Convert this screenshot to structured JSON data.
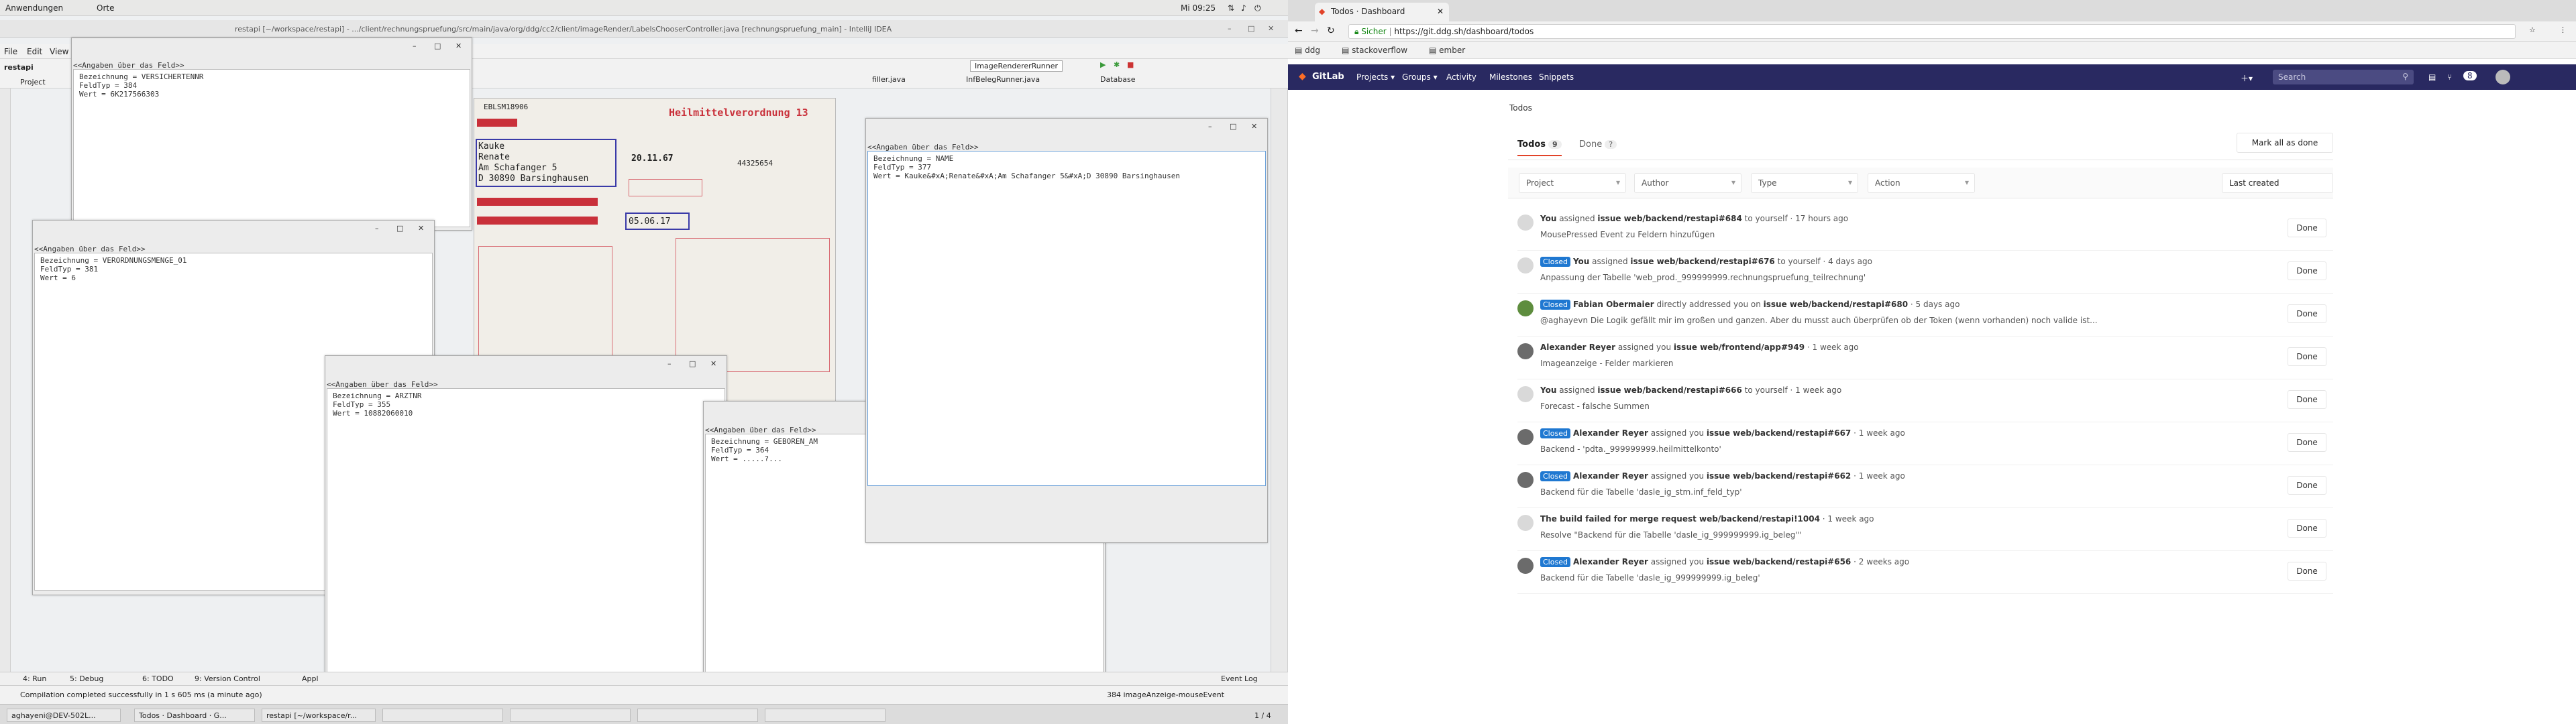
{
  "topbar": {
    "apps": "Anwendungen",
    "places": "Orte",
    "clock": "Mi 09:25"
  },
  "idea": {
    "title": "restapi [~/workspace/restapi] - .../client/rechnungspruefung/src/main/java/org/ddg/cc2/client/imageRender/LabelsChooserController.java [rechnungspruefung_main] - IntelliJ IDEA",
    "menu": [
      "File",
      "Edit",
      "View"
    ],
    "project_tab": "restapi",
    "project_label": "Project",
    "run_config": "ImageRendererRunner",
    "editor_tabs": [
      "filler.java",
      "InfBelegRunner.java"
    ],
    "database_label": "Database",
    "bottom_tabs": [
      "4: Run",
      "5: Debug",
      "6: TODO",
      "9: Version Control",
      "Appl"
    ],
    "event_log": "Event Log",
    "status": "Compilation completed successfully in 1 s 605 ms (a minute ago)",
    "status_right": "384 imageAnzeige-mouseEvent",
    "page_count": "1 / 4"
  },
  "dialogs": [
    {
      "header": "<<Angaben über das Feld>>",
      "lines": [
        "Bezeichnung = VERSICHERTENNR",
        "FeldTyp = 384",
        "Wert = 6K217566303"
      ]
    },
    {
      "header": "<<Angaben über das Feld>>",
      "lines": [
        "Bezeichnung = VERORDNUNGSMENGE_01",
        "FeldTyp = 381",
        "Wert = 6"
      ]
    },
    {
      "header": "<<Angaben über das Feld>>",
      "lines": [
        "Bezeichnung = ARZTNR",
        "FeldTyp = 355",
        "Wert = 10882060010"
      ]
    },
    {
      "header": "<<Angaben über das Feld>>",
      "lines": [
        "Bezeichnung = GEBOREN_AM",
        "FeldTyp = 364",
        "Wert = .....?..."
      ]
    },
    {
      "header": "<<Angaben über das Feld>>",
      "lines": [
        "Bezeichnung = NAME",
        "FeldTyp = 377",
        "Wert = Kauke&#xA;Renate&#xA;Am Schafanger 5&#xA;D 30890 Barsinghausen"
      ]
    }
  ],
  "scan": {
    "form_title": "Heilmittelverordnung 13",
    "name1": "Kauke",
    "name2": "Renate",
    "street": "Am Schafanger 5",
    "city": "D 30890 Barsinghausen",
    "date1": "20.11.67",
    "date2": "05.06.17",
    "number": "44325654",
    "ebls": "EBLSM18906"
  },
  "taskbar": [
    "aghayeni@DEV-502L...",
    "Todos · Dashboard · G...",
    "restapi [~/workspace/r..."
  ],
  "browser": {
    "tab_title": "Todos · Dashboard",
    "secure": "Sicher",
    "url": "https://git.ddg.sh/dashboard/todos",
    "bookmarks": [
      "ddg",
      "stackoverflow",
      "ember"
    ]
  },
  "gitlab": {
    "brand": "GitLab",
    "nav": [
      "Projects ▾",
      "Groups ▾",
      "Activity",
      "Milestones",
      "Snippets"
    ],
    "search_placeholder": "Search",
    "todo_count": "8",
    "page_title": "Todos",
    "tab_todos": "Todos",
    "tab_todos_count": "9",
    "tab_done": "Done",
    "tab_done_count": "?",
    "mark_all": "Mark all as done",
    "filters": [
      "Project",
      "Author",
      "Type",
      "Action"
    ],
    "sort": "Last created",
    "done_label": "Done",
    "todos": [
      {
        "closed": "",
        "actor": "You",
        "text": " assigned ",
        "ref": "issue web/backend/restapi#684",
        "tail": " to yourself · 17 hours ago",
        "desc": "MousePressed Event zu Feldern hinzufügen",
        "avatar": "default"
      },
      {
        "closed": "Closed",
        "actor": "You",
        "text": " assigned ",
        "ref": "issue web/backend/restapi#676",
        "tail": " to yourself · 4 days ago",
        "desc": "Anpassung der Tabelle 'web_prod._999999999.rechnungspruefung_teilrechnung'",
        "avatar": "default"
      },
      {
        "closed": "Closed",
        "actor": "Fabian Obermaier",
        "text": " directly addressed you on ",
        "ref": "issue web/backend/restapi#680",
        "tail": " · 5 days ago",
        "desc": "@aghayevn Die Logik gefällt mir im großen und ganzen. Aber du musst auch überprüfen ob der Token (wenn vorhanden) noch valide ist...",
        "avatar": "green"
      },
      {
        "closed": "",
        "actor": "Alexander Reyer",
        "text": " assigned you ",
        "ref": "issue web/frontend/app#949",
        "tail": " · 1 week ago",
        "desc": "Imageanzeige - Felder markieren",
        "avatar": "photo"
      },
      {
        "closed": "",
        "actor": "You",
        "text": " assigned ",
        "ref": "issue web/backend/restapi#666",
        "tail": " to yourself · 1 week ago",
        "desc": "Forecast - falsche Summen",
        "avatar": "default"
      },
      {
        "closed": "Closed",
        "actor": "Alexander Reyer",
        "text": " assigned you ",
        "ref": "issue web/backend/restapi#667",
        "tail": " · 1 week ago",
        "desc": "Backend - 'pdta._999999999.heilmittelkonto'",
        "avatar": "photo"
      },
      {
        "closed": "Closed",
        "actor": "Alexander Reyer",
        "text": " assigned you ",
        "ref": "issue web/backend/restapi#662",
        "tail": " · 1 week ago",
        "desc": "Backend für die Tabelle 'dasle_ig_stm.inf_feld_typ'",
        "avatar": "photo"
      },
      {
        "closed": "",
        "actor": "The build failed for ",
        "text": "",
        "ref": "merge request web/backend/restapi!1004",
        "tail": " · 1 week ago",
        "desc": "Resolve \"Backend für die Tabelle 'dasle_ig_999999999.ig_beleg'\"",
        "avatar": "default"
      },
      {
        "closed": "Closed",
        "actor": "Alexander Reyer",
        "text": " assigned you ",
        "ref": "issue web/backend/restapi#656",
        "tail": " · 2 weeks ago",
        "desc": "Backend für die Tabelle 'dasle_ig_999999999.ig_beleg'",
        "avatar": "photo"
      }
    ]
  }
}
